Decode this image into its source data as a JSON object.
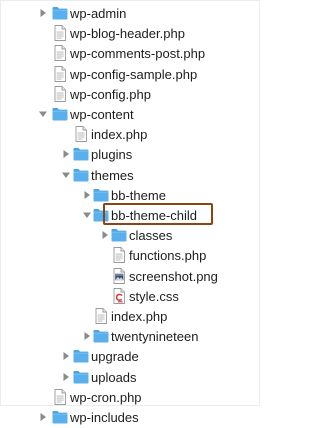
{
  "file_tree": {
    "items": [
      {
        "label": "wp-admin",
        "kind": "folder",
        "expanded": false,
        "depth": 0
      },
      {
        "label": "wp-blog-header.php",
        "kind": "file",
        "depth": 0
      },
      {
        "label": "wp-comments-post.php",
        "kind": "file",
        "depth": 0
      },
      {
        "label": "wp-config-sample.php",
        "kind": "file",
        "depth": 0
      },
      {
        "label": "wp-config.php",
        "kind": "file",
        "depth": 0
      },
      {
        "label": "wp-content",
        "kind": "folder",
        "expanded": true,
        "depth": 0
      },
      {
        "label": "index.php",
        "kind": "file",
        "depth": 1
      },
      {
        "label": "plugins",
        "kind": "folder",
        "expanded": false,
        "depth": 1
      },
      {
        "label": "themes",
        "kind": "folder",
        "expanded": true,
        "depth": 1
      },
      {
        "label": "bb-theme",
        "kind": "folder",
        "expanded": false,
        "depth": 2
      },
      {
        "label": "bb-theme-child",
        "kind": "folder",
        "expanded": true,
        "depth": 2
      },
      {
        "label": "classes",
        "kind": "folder",
        "expanded": false,
        "depth": 3
      },
      {
        "label": "functions.php",
        "kind": "file",
        "depth": 3,
        "highlighted": true
      },
      {
        "label": "screenshot.png",
        "kind": "image",
        "depth": 3
      },
      {
        "label": "style.css",
        "kind": "css",
        "depth": 3
      },
      {
        "label": "index.php",
        "kind": "file",
        "depth": 2
      },
      {
        "label": "twentynineteen",
        "kind": "folder",
        "expanded": false,
        "depth": 2
      },
      {
        "label": "upgrade",
        "kind": "folder",
        "expanded": false,
        "depth": 1
      },
      {
        "label": "uploads",
        "kind": "folder",
        "expanded": false,
        "depth": 1
      },
      {
        "label": "wp-cron.php",
        "kind": "file",
        "depth": 0
      },
      {
        "label": "wp-includes",
        "kind": "folder",
        "expanded": false,
        "depth": 0
      }
    ],
    "icons": {
      "folder": "folder-icon",
      "file": "php-file-icon",
      "image": "png-file-icon",
      "css": "css-file-icon"
    },
    "colors": {
      "folder": "#5ab0ec",
      "folder_tab": "#4aa3e2",
      "highlight_border": "#8b4513",
      "disclosure": "#8a8a8a",
      "text": "#1d1d1f"
    }
  }
}
